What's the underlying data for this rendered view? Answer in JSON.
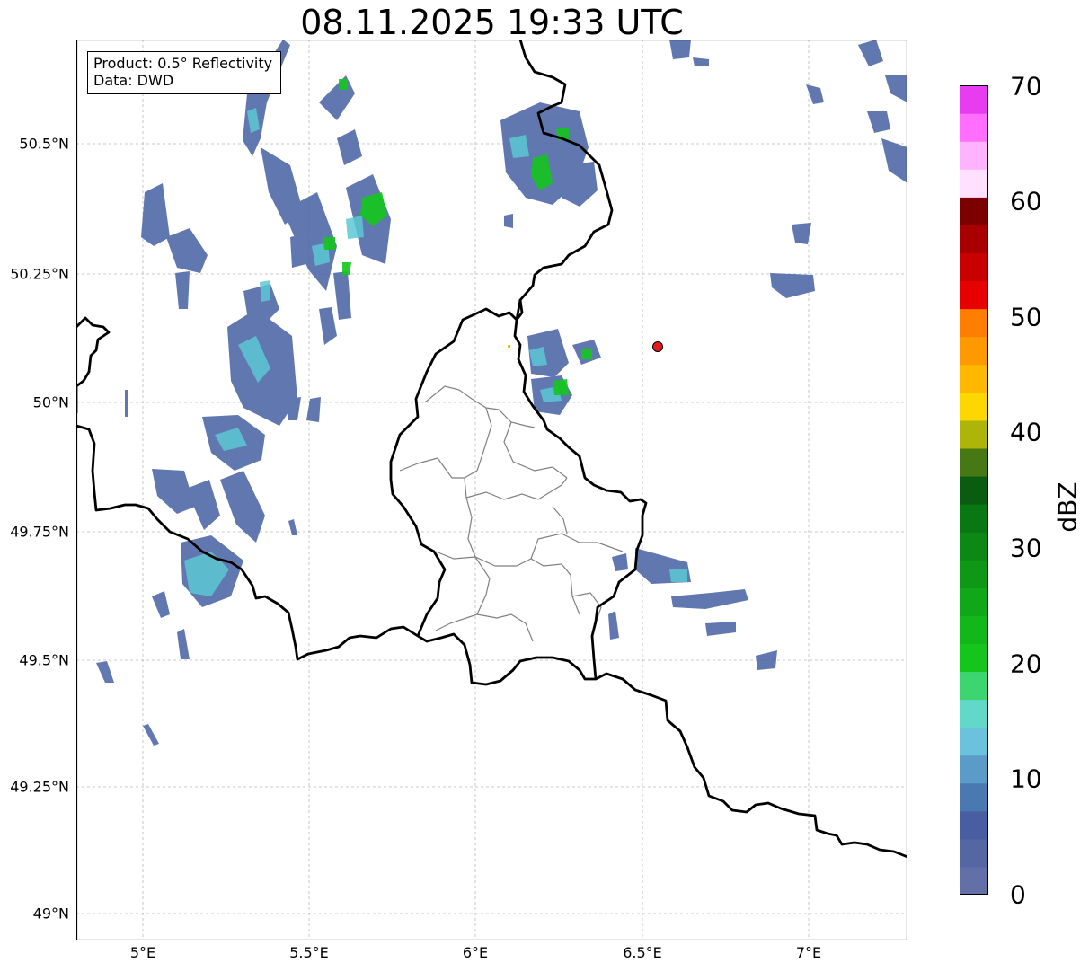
{
  "title": "08.11.2025 19:33 UTC",
  "info": {
    "product": "Product: 0.5° Reflectivity",
    "data": "Data: DWD"
  },
  "axes": {
    "lat_ticks": [
      "49°N",
      "49.25°N",
      "49.5°N",
      "49.75°N",
      "50°N",
      "50.25°N",
      "50.5°N"
    ],
    "lon_ticks": [
      "5°E",
      "5.5°E",
      "6°E",
      "6.5°E",
      "7°E"
    ],
    "lon_range": [
      4.8,
      7.3
    ],
    "lat_range": [
      48.95,
      50.7
    ]
  },
  "colorbar": {
    "title": "dBZ",
    "labels": [
      "0",
      "10",
      "20",
      "30",
      "40",
      "50",
      "60",
      "70"
    ],
    "range": [
      0,
      70
    ],
    "colors": [
      "#6370a8",
      "#5567a2",
      "#485ea0",
      "#4a78b0",
      "#5a9bc8",
      "#6ac2dc",
      "#62d8c8",
      "#3dd570",
      "#14c61c",
      "#12b81a",
      "#10a818",
      "#0e9816",
      "#0c8814",
      "#0a7812",
      "#0a5c10",
      "#467814",
      "#adb40a",
      "#ffd700",
      "#ffb800",
      "#ff9900",
      "#ff7e00",
      "#e60000",
      "#c80000",
      "#a80000",
      "#7d0000",
      "#ffe0ff",
      "#ffb3ff",
      "#ff6eff",
      "#e73cf0"
    ]
  },
  "marker": {
    "label": "radar-site",
    "color": "#e41a1c"
  }
}
